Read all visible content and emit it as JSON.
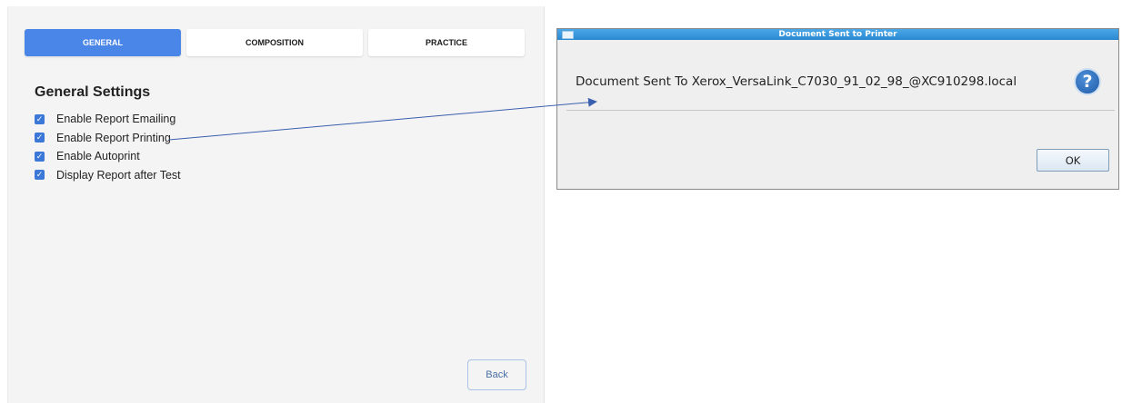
{
  "settings": {
    "tabs": [
      {
        "label": "GENERAL",
        "active": true
      },
      {
        "label": "COMPOSITION",
        "active": false
      },
      {
        "label": "PRACTICE",
        "active": false
      }
    ],
    "section_title": "General Settings",
    "options": [
      {
        "label": "Enable Report Emailing",
        "checked": true
      },
      {
        "label": "Enable Report Printing",
        "checked": true
      },
      {
        "label": "Enable Autoprint",
        "checked": true
      },
      {
        "label": "Display Report after Test",
        "checked": true
      }
    ],
    "back_label": "Back"
  },
  "dialog": {
    "title": "Document Sent to Printer",
    "message": "Document Sent To Xerox_VersaLink_C7030_91_02_98_@XC910298.local",
    "icon": "question-icon",
    "icon_glyph": "?",
    "ok_label": "OK"
  },
  "colors": {
    "accent": "#4a86e8",
    "checkbox": "#3b78d8",
    "titlebar": "#2b88d2",
    "arrow": "#3a5fae"
  }
}
